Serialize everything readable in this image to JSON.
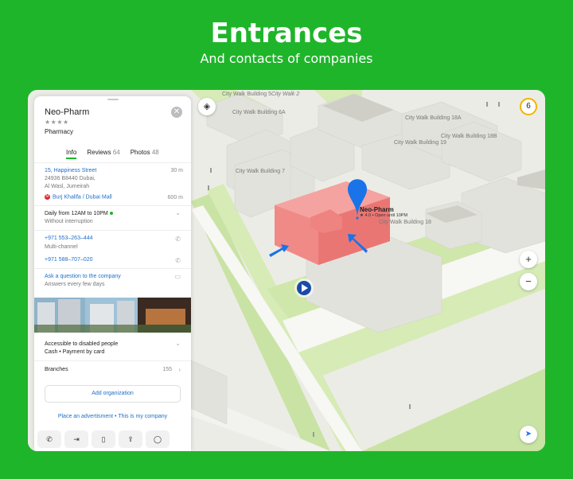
{
  "hero": {
    "title": "Entrances",
    "subtitle": "And contacts of companies"
  },
  "map": {
    "labels": {
      "cw5": "City Walk Building 5",
      "cw2": "City Walk 2",
      "cw6a": "City Walk Building 6A",
      "cw18a": "City Walk Building 18A",
      "cw18b": "City Walk Building 18B",
      "cw19": "City Walk Building 19",
      "cw7": "City Walk Building 7",
      "cw18": "City Walk Building 18"
    },
    "pin": {
      "name": "Neo-Pharm",
      "rating": "★ 4.0",
      "status": "Open until 10PM"
    },
    "badge_count": "6",
    "zoom_in": "+",
    "zoom_out": "−"
  },
  "panel": {
    "title": "Neo-Pharm",
    "stars": "★★★★",
    "category": "Pharmacy",
    "tabs": [
      {
        "label": "Info",
        "count": ""
      },
      {
        "label": "Reviews",
        "count": "64"
      },
      {
        "label": "Photos",
        "count": "48"
      }
    ],
    "address": {
      "street": "15, Happiness Street",
      "distance": "30 m",
      "line2": "24936 B8440 Dubai,",
      "line3": "Al Wasl, Jumeirah"
    },
    "metro": {
      "icon": "M",
      "name": "Burj Khalifa / Dubai Mall",
      "distance": "600 m"
    },
    "hours": {
      "main": "Daily from 12AM to 10PM",
      "sub": "Without interruption"
    },
    "phones": [
      {
        "number": "+971 553–263–444",
        "note": "Multi-channel"
      },
      {
        "number": "+971 588–707–020",
        "note": ""
      }
    ],
    "question": {
      "link": "Ask a question to the company",
      "sub": "Answers every few days"
    },
    "access": {
      "main": "Accessible to disabled people",
      "sub": "Cash  •  Payment by card"
    },
    "branches": {
      "label": "Branches",
      "count": "155"
    },
    "add_org": "Add organization",
    "footer": {
      "ad": "Place an advertisment",
      "sep": " • ",
      "mine": "This is my company"
    }
  },
  "colors": {
    "brand": "#1fb52a",
    "link": "#1e6fc8",
    "building_highlight": "#f08a86",
    "pin": "#1a73e8"
  }
}
